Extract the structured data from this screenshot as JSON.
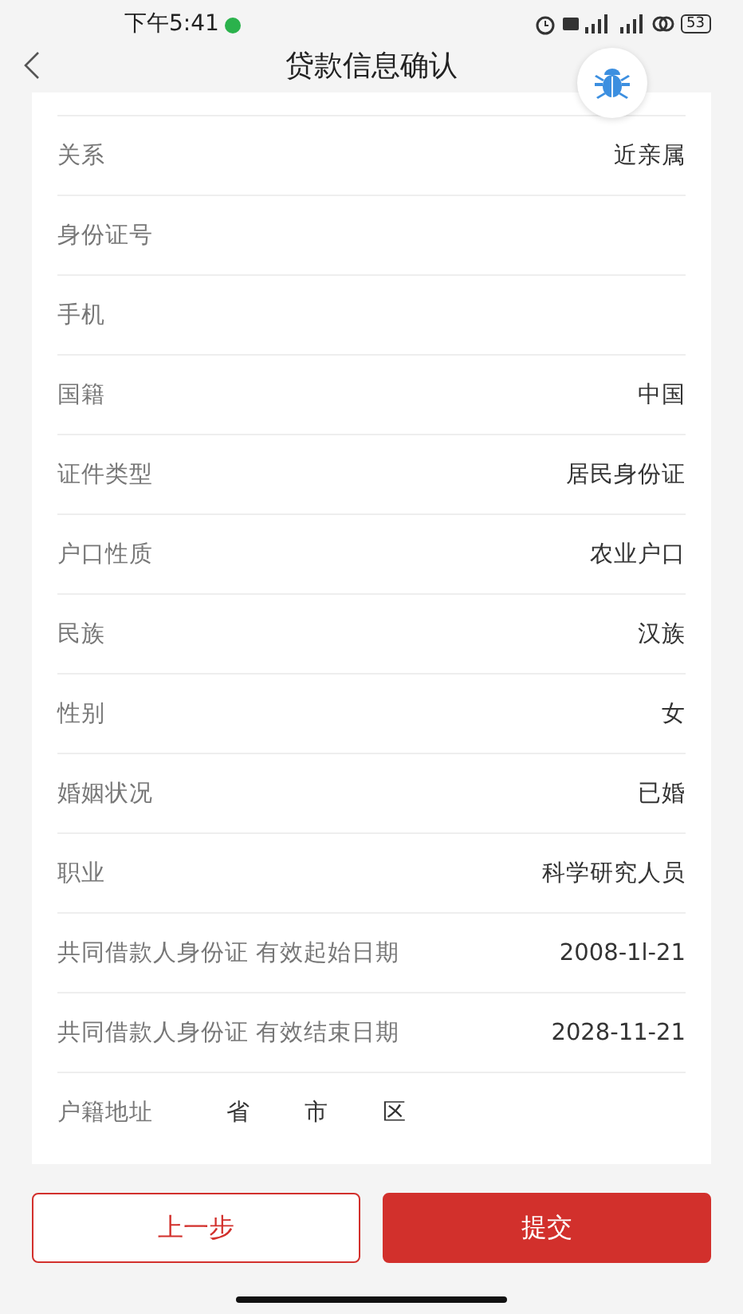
{
  "status_bar": {
    "time": "下午5:41",
    "battery": "53"
  },
  "header": {
    "title": "贷款信息确认"
  },
  "rows": [
    {
      "kind": "pair",
      "label": "关系",
      "value": "近亲属"
    },
    {
      "kind": "pair",
      "label": "身份证号"
    },
    {
      "kind": "pair",
      "label": "手机"
    },
    {
      "kind": "pair",
      "label": "国籍",
      "value": "中国"
    },
    {
      "kind": "pair",
      "label": "证件类型",
      "value": "居民身份证"
    },
    {
      "kind": "pair",
      "label": "户口性质",
      "value": "农业户口"
    },
    {
      "kind": "pair",
      "label": "民族",
      "value": "汉族"
    },
    {
      "kind": "pair",
      "label": "性别",
      "value": "女"
    },
    {
      "kind": "pair",
      "label": "婚姻状况",
      "value": "已婚"
    },
    {
      "kind": "pair",
      "label": "职业",
      "value": "科学研究人员"
    },
    {
      "kind": "pair",
      "label": "共同借款人身份证 有效起始日期",
      "value": "2008-1l-21"
    },
    {
      "kind": "pair",
      "label": "共同借款人身份证 有效结束日期",
      "value": "2028-11-21"
    },
    {
      "kind": "address",
      "label": "户籍地址",
      "parts": [
        "省",
        "市",
        "区"
      ]
    }
  ],
  "buttons": {
    "back": "上一步",
    "submit": "提交"
  }
}
